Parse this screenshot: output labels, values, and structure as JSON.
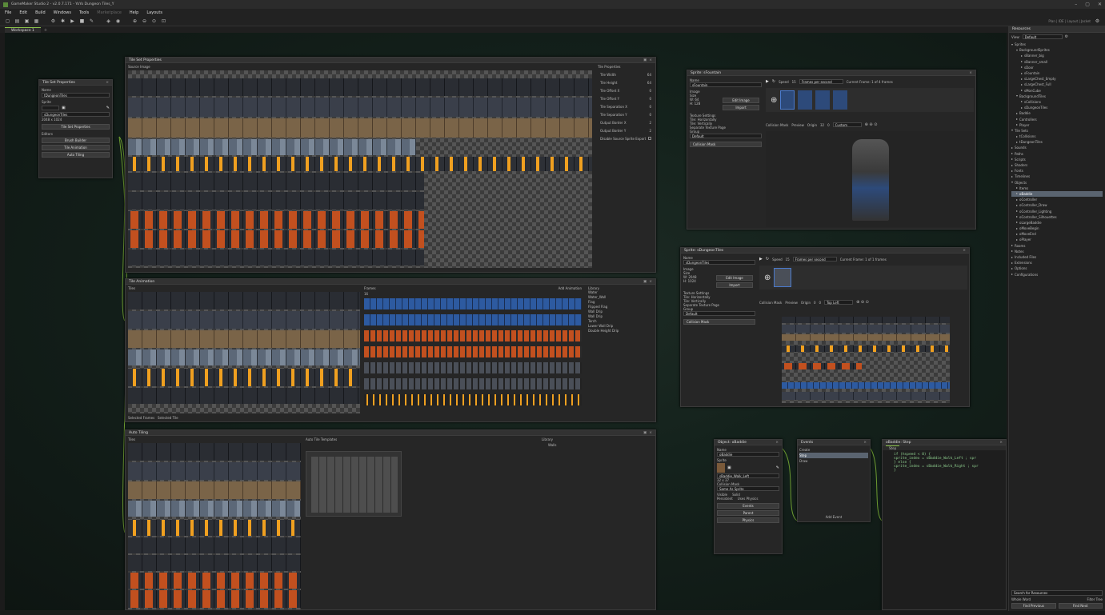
{
  "window": {
    "title": "GameMaker Studio 2 - v2.0.7.171 - YoYo Dungeon Tiles_Y",
    "controls": [
      "–",
      "▢",
      "✕"
    ]
  },
  "menu": [
    "File",
    "Edit",
    "Build",
    "Windows",
    "Tools",
    "Marketplace",
    "Help",
    "Layouts"
  ],
  "toolbar_right": "Plan | IDE | Layout | Jacket",
  "workspace_tab": "Workspace 1",
  "colors": {
    "accent": "#8bc34a",
    "selection": "#5a6470",
    "panel": "#262626"
  },
  "tileset_props_panel": {
    "title": "Tile Set Properties",
    "name_label": "Name",
    "name_value": "tDungeonTiles",
    "sprite_label": "Sprite",
    "sprite_value": "sDungeonTiles",
    "size_value": "2048 x 1024",
    "open_props": "Tile Set Properties",
    "editors_label": "Editors",
    "brush_builder": "Brush Builder",
    "tile_animation": "Tile Animation",
    "auto_tiling": "Auto Tiling"
  },
  "tileset_editor": {
    "title": "Tile Set Properties",
    "source_label": "Source Image",
    "properties_label": "Tile Properties",
    "props": [
      {
        "k": "Tile Width",
        "v": "64"
      },
      {
        "k": "Tile Height",
        "v": "64"
      },
      {
        "k": "Tile Offset X",
        "v": "0"
      },
      {
        "k": "Tile Offset Y",
        "v": "0"
      },
      {
        "k": "Tile Separation X",
        "v": "0"
      },
      {
        "k": "Tile Separation Y",
        "v": "0"
      },
      {
        "k": "Output Border X",
        "v": "2"
      },
      {
        "k": "Output Border Y",
        "v": "2"
      },
      {
        "k": "Disable Source Sprite Export",
        "v": ""
      }
    ]
  },
  "tile_animation": {
    "title": "Tile Animation",
    "tiles_label": "Tiles",
    "frames_label": "Frames",
    "frame_count": "16",
    "add_animation": "Add Animation",
    "library_label": "Library",
    "library": [
      "Water",
      "Water_Wall",
      "Flag",
      "Flipped Flag",
      "Wall Drip",
      "Wall Drip",
      "Torch",
      "Lower Wall Drip",
      "Double Height Drip"
    ],
    "selected_frames": "Selected Frames",
    "selected_tile": "Selected Tile"
  },
  "auto_tiling": {
    "title": "Auto Tiling",
    "tiles_label": "Tiles",
    "templates_label": "Auto Tile Templates",
    "library_label": "Library",
    "library": [
      "Walls"
    ]
  },
  "sprite_fountain": {
    "title": "Sprite: sFountain",
    "name_label": "Name",
    "name_value": "sFountain",
    "image_label": "Image",
    "size_label": "Size",
    "w": "W: 64",
    "h": "H: 128",
    "edit_image": "Edit Image",
    "import": "Import",
    "texture_label": "Texture Settings",
    "tile_h": "Tile: Horizontally",
    "tile_v": "Tile: Vertically",
    "separate_page": "Separate Texture Page",
    "group_label": "Group",
    "group_value": "Default",
    "collision_mask": "Collision Mask",
    "speed_label": "Speed",
    "speed_value": "15",
    "speed_unit": "Frames per second",
    "current_frame": "Current Frame: 1 of 4 frames",
    "mask_label": "Collision Mask",
    "preview": "Preview",
    "origin_label": "Origin",
    "origin_x": "32",
    "origin_y": "0",
    "origin_mode": "Custom"
  },
  "sprite_tiles": {
    "title": "Sprite: sDungeonTiles",
    "name_value": "sDungeonTiles",
    "w": "W: 2048",
    "h": "H: 1024",
    "edit_image": "Edit Image",
    "import": "Import",
    "group_value": "Default",
    "speed_value": "15",
    "speed_unit": "Frames per second",
    "current_frame": "Current Frame: 1 of 1 frames",
    "origin_x": "0",
    "origin_y": "0",
    "origin_mode": "Top Left"
  },
  "object_panel": {
    "title": "Object: oBaddie",
    "name_label": "Name",
    "name_value": "oBaddie",
    "sprite_label": "Sprite",
    "sprite_value": "sBaddie_Walk_Left",
    "sprite_size": "32 x 37",
    "mask_label": "Collision Mask",
    "mask_value": "Same As Sprite",
    "visible": "Visible",
    "solid": "Solid",
    "persistent": "Persistent",
    "uses_physics": "Uses Physics",
    "events": "Events",
    "parent": "Parent",
    "physics": "Physics"
  },
  "events_panel": {
    "title": "Events",
    "events": [
      "Create",
      "Step",
      "Draw"
    ],
    "add_event": "Add Event"
  },
  "code_panel": {
    "title": "oBaddie: Step",
    "tab": "Step",
    "lines": [
      "if (hspeed < 0) {",
      "    sprite_index = sBaddie_Walk_Left ; spr",
      "} else {",
      "    sprite_index = sBaddie_Walk_Right ; spr",
      "}"
    ]
  },
  "resources": {
    "title": "Resources",
    "view_label": "View:",
    "view_value": "Default",
    "tree": [
      {
        "label": "Sprites",
        "depth": 0,
        "open": true
      },
      {
        "label": "BackgroundSprites",
        "depth": 1,
        "open": true
      },
      {
        "label": "sBanner_big",
        "depth": 2
      },
      {
        "label": "sBanner_small",
        "depth": 2
      },
      {
        "label": "sDoor",
        "depth": 2
      },
      {
        "label": "sFountain",
        "depth": 2
      },
      {
        "label": "sLargeChest_Empty",
        "depth": 2
      },
      {
        "label": "sLargeChest_Full",
        "depth": 2
      },
      {
        "label": "sMonCube",
        "depth": 2
      },
      {
        "label": "BackgroundTiles",
        "depth": 1,
        "open": true
      },
      {
        "label": "sCollisions",
        "depth": 2
      },
      {
        "label": "sDungeonTiles",
        "depth": 2
      },
      {
        "label": "Baddie",
        "depth": 1
      },
      {
        "label": "Controllers",
        "depth": 1
      },
      {
        "label": "Player",
        "depth": 1
      },
      {
        "label": "Tile Sets",
        "depth": 0,
        "open": true
      },
      {
        "label": "tCollisions",
        "depth": 1
      },
      {
        "label": "tDungeonTiles",
        "depth": 1
      },
      {
        "label": "Sounds",
        "depth": 0
      },
      {
        "label": "Paths",
        "depth": 0
      },
      {
        "label": "Scripts",
        "depth": 0
      },
      {
        "label": "Shaders",
        "depth": 0
      },
      {
        "label": "Fonts",
        "depth": 0
      },
      {
        "label": "Timelines",
        "depth": 0
      },
      {
        "label": "Objects",
        "depth": 0,
        "open": true
      },
      {
        "label": "Items",
        "depth": 1
      },
      {
        "label": "oBaddie",
        "depth": 1,
        "selected": true
      },
      {
        "label": "oController",
        "depth": 1
      },
      {
        "label": "oController_Draw",
        "depth": 1
      },
      {
        "label": "oController_Lighting",
        "depth": 1
      },
      {
        "label": "oController_Silhouettes",
        "depth": 1
      },
      {
        "label": "oLargeBaddie",
        "depth": 1
      },
      {
        "label": "oMoveBegin",
        "depth": 1
      },
      {
        "label": "oMoveEnd",
        "depth": 1
      },
      {
        "label": "oPlayer",
        "depth": 1
      },
      {
        "label": "Rooms",
        "depth": 0
      },
      {
        "label": "Notes",
        "depth": 0
      },
      {
        "label": "Included Files",
        "depth": 0
      },
      {
        "label": "Extensions",
        "depth": 0
      },
      {
        "label": "Options",
        "depth": 0
      },
      {
        "label": "Configurations",
        "depth": 0
      }
    ],
    "search_placeholder": "Search for Resources",
    "whole_word": "Whole Word",
    "filter_tree": "Filter Tree",
    "find_previous": "Find Previous",
    "find_next": "Find Next"
  }
}
